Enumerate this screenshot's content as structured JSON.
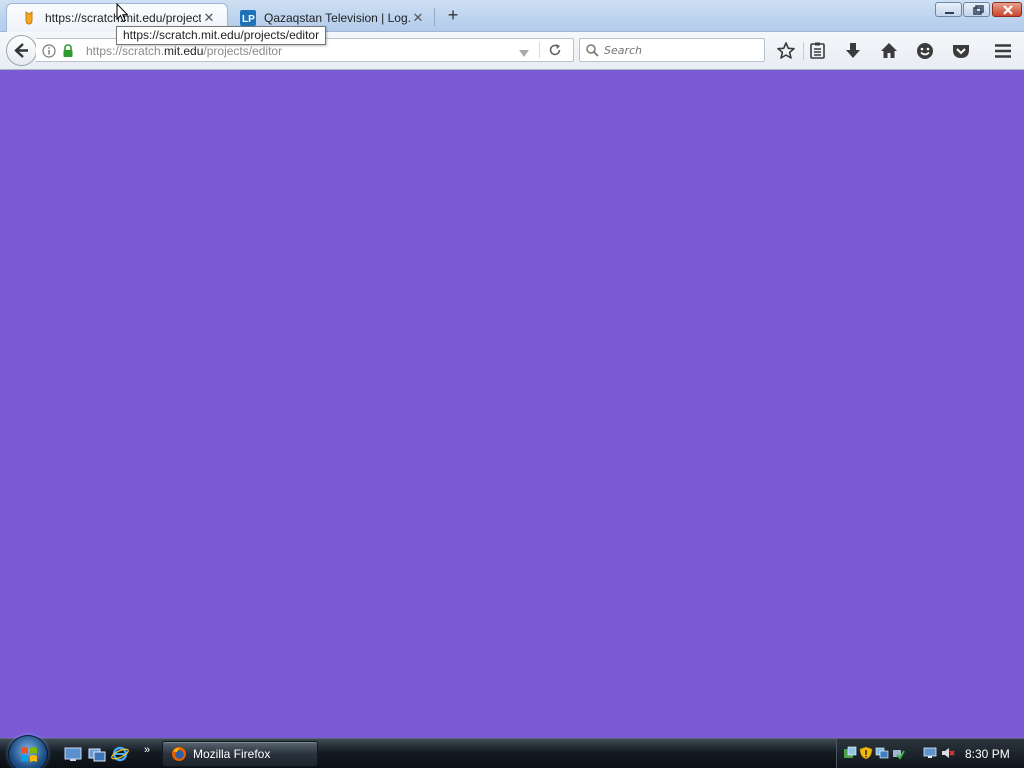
{
  "browser": {
    "tabs": [
      {
        "label": "https://scratch.mit.edu/projects/editor",
        "active": true,
        "favicon": "scratch-cat-icon"
      },
      {
        "label": "Qazaqstan Television | Log...",
        "active": false,
        "favicon": "lp-icon"
      }
    ],
    "new_tab_label": "+",
    "tooltip": "https://scratch.mit.edu/projects/editor",
    "url": {
      "prefix": "https://scratch.",
      "domain": "mit.edu",
      "path": "/projects/editor"
    },
    "search_placeholder": "Search",
    "toolbar_icons": [
      "bookmark-star-icon",
      "reading-list-icon",
      "download-icon",
      "home-icon",
      "hello-chat-icon",
      "pocket-icon",
      "menu-icon"
    ]
  },
  "page": {
    "background_color": "#7d5ad5"
  },
  "taskbar": {
    "task_label": "Mozilla Firefox",
    "clock": "8:30 PM",
    "quick_launch": [
      "show-desktop-icon",
      "switch-windows-icon",
      "internet-explorer-icon"
    ],
    "more_label": "»"
  }
}
